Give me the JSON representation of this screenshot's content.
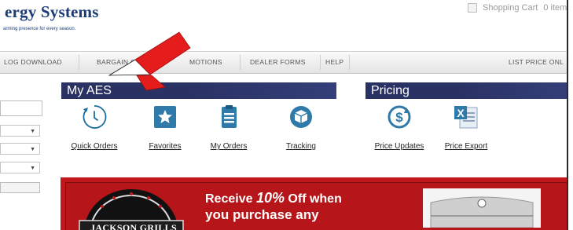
{
  "brand": {
    "name": "ergy Systems",
    "tagline": "arming presence for every season."
  },
  "cart": {
    "label": "Shopping Cart",
    "count_text": "0 item"
  },
  "nav": {
    "items": [
      {
        "label": "LOG DOWNLOAD"
      },
      {
        "label": "BARGAIN CORNA"
      },
      {
        "label": "MOTIONS"
      },
      {
        "label": "DEALER FORMS"
      },
      {
        "label": "HELP"
      },
      {
        "label": "LIST PRICE ONL"
      }
    ]
  },
  "sidebar": {
    "dropdown_caret": "▼"
  },
  "my_aes": {
    "title": "My AES",
    "links": [
      {
        "label": "Quick Orders",
        "icon": "stopwatch-icon"
      },
      {
        "label": "Favorites",
        "icon": "star-icon"
      },
      {
        "label": "My Orders",
        "icon": "clipboard-icon"
      },
      {
        "label": "Tracking",
        "icon": "package-icon"
      }
    ]
  },
  "pricing": {
    "title": "Pricing",
    "links": [
      {
        "label": "Price Updates",
        "icon": "dollar-refresh-icon"
      },
      {
        "label": "Price Export",
        "icon": "excel-icon"
      }
    ]
  },
  "promo": {
    "line1_pre": "Receive ",
    "line1_em": "10%",
    "line1_post": " Off when",
    "line2": "you purchase any",
    "logo_text": "JACKSON GRILLS"
  },
  "colors": {
    "brand_blue": "#1c3c78",
    "panel_header": "#2a3163",
    "icon_teal": "#1a6e9a",
    "promo_red": "#c1191b",
    "arrow_red": "#e41c1c"
  }
}
